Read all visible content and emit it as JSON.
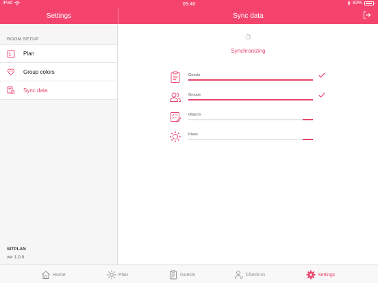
{
  "status_bar": {
    "device": "iPad",
    "time": "09:40",
    "battery": "83%"
  },
  "sidebar": {
    "title": "Settings",
    "section_label": "ROOM SETUP",
    "items": [
      {
        "label": "Plan",
        "icon": "plan-icon",
        "active": false
      },
      {
        "label": "Group colors",
        "icon": "palette-icon",
        "active": false
      },
      {
        "label": "Sync data",
        "icon": "sync-data-icon",
        "active": true
      }
    ],
    "app_name": "SITPLAN",
    "version": "ver 1.0.0"
  },
  "main": {
    "title": "Sync data",
    "status": "Synchronizing",
    "items": [
      {
        "label": "Guests",
        "icon": "clipboard-icon",
        "progress": 1.0,
        "done": true
      },
      {
        "label": "Groups",
        "icon": "users-icon",
        "progress": 1.0,
        "done": true
      },
      {
        "label": "Objects",
        "icon": "checklist-icon",
        "progress": 0.08,
        "done": false
      },
      {
        "label": "Plans",
        "icon": "gear-icon",
        "progress": 0.08,
        "done": false
      }
    ]
  },
  "tabbar": {
    "tabs": [
      {
        "label": "Home",
        "icon": "home-icon",
        "active": false
      },
      {
        "label": "Plan",
        "icon": "plan-spark-icon",
        "active": false
      },
      {
        "label": "Guests",
        "icon": "clipboard-icon",
        "active": false
      },
      {
        "label": "Check-In",
        "icon": "person-check-icon",
        "active": false
      },
      {
        "label": "Settings",
        "icon": "gear-icon",
        "active": true
      }
    ]
  },
  "colors": {
    "accent": "#f4446e",
    "accent_text": "#e8436b"
  }
}
